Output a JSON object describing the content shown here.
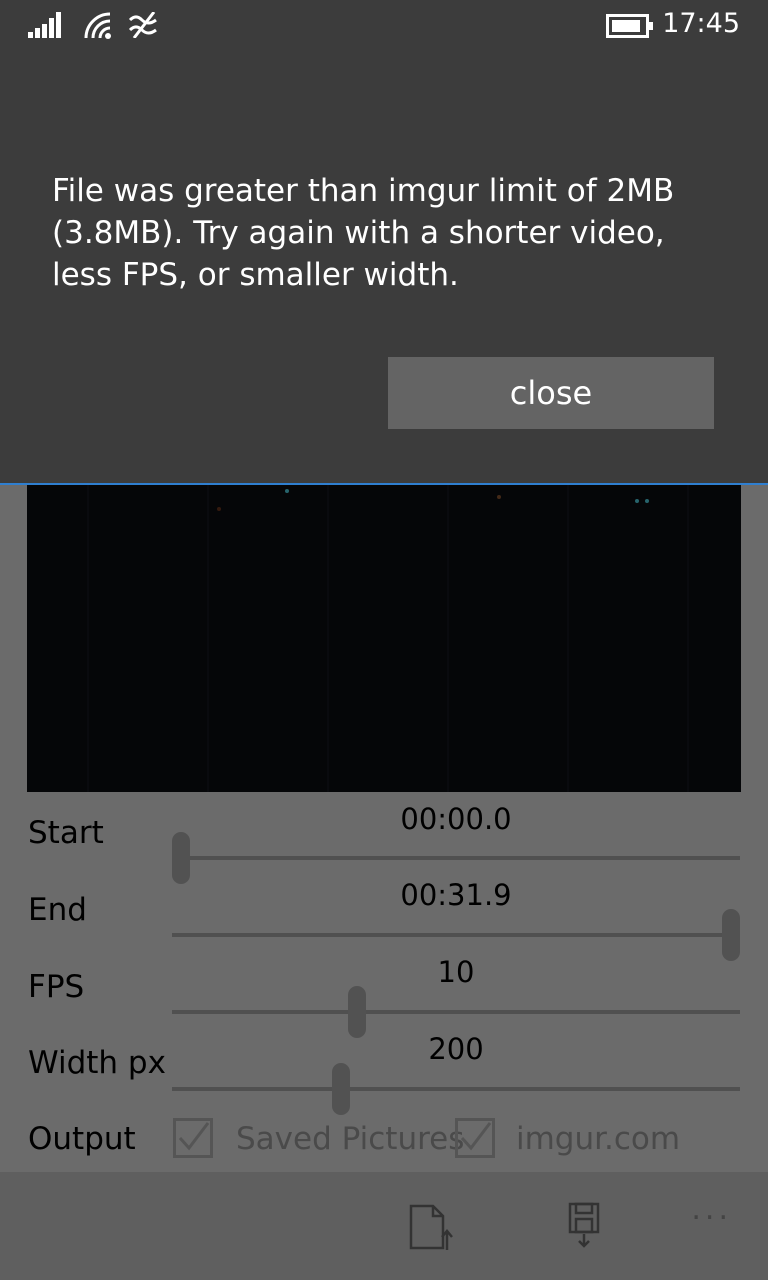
{
  "status_bar": {
    "time": "17:45",
    "icons": [
      "signal-icon",
      "wifi-icon",
      "data-sense-icon",
      "battery-icon"
    ]
  },
  "dialog": {
    "message": "File was greater than imgur limit of 2MB (3.8MB). Try again with a shorter video, less FPS, or smaller width.",
    "close_label": "close",
    "accent_color": "#2f7fd0"
  },
  "controls": {
    "start": {
      "label": "Start",
      "value": "00:00.0",
      "slider_fraction": 0.0
    },
    "end": {
      "label": "End",
      "value": "00:31.9",
      "slider_fraction": 1.0
    },
    "fps": {
      "label": "FPS",
      "value": "10",
      "slider_fraction": 0.32
    },
    "width": {
      "label": "Width px",
      "value": "200",
      "slider_fraction": 0.29
    }
  },
  "output": {
    "label": "Output",
    "options": [
      {
        "label": "Saved Pictures",
        "checked": true
      },
      {
        "label": "imgur.com",
        "checked": true
      }
    ]
  },
  "appbar": {
    "icons": [
      "upload-file-icon",
      "save-icon",
      "more-icon"
    ],
    "more_label": "..."
  }
}
